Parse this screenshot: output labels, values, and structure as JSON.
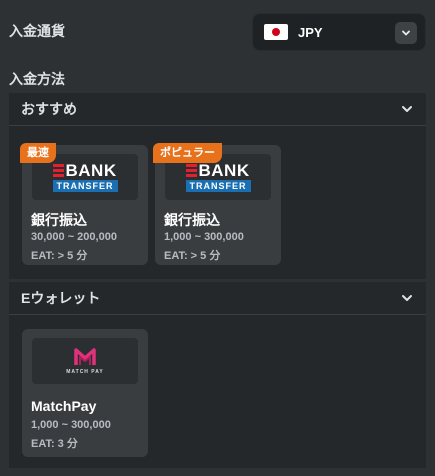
{
  "currency": {
    "label": "入金通貨",
    "selected": "JPY",
    "flag_icon": "japan-flag-icon"
  },
  "payment": {
    "label": "入金方法"
  },
  "sections": [
    {
      "title": "おすすめ",
      "methods": [
        {
          "badge": "最速",
          "logo": "bank-transfer-logo",
          "logo_text_top": "BANK",
          "logo_text_bottom": "TRANSFER",
          "name": "銀行振込",
          "range": "30,000 ~ 200,000",
          "eat": "EAT: > 5 分"
        },
        {
          "badge": "ポピュラー",
          "logo": "bank-transfer-logo",
          "logo_text_top": "BANK",
          "logo_text_bottom": "TRANSFER",
          "name": "銀行振込",
          "range": "1,000 ~ 300,000",
          "eat": "EAT: > 5 分"
        }
      ]
    },
    {
      "title": "Eウォレット",
      "methods": [
        {
          "logo": "matchpay-logo",
          "logo_text": "MATCH PAY",
          "name": "MatchPay",
          "range": "1,000 ~ 300,000",
          "eat": "EAT: 3 分"
        }
      ]
    }
  ],
  "colors": {
    "badge": "#e8711b",
    "bank_red": "#e5202e",
    "bank_blue": "#1a6fb3",
    "matchpay_pink": "#e0327a"
  }
}
